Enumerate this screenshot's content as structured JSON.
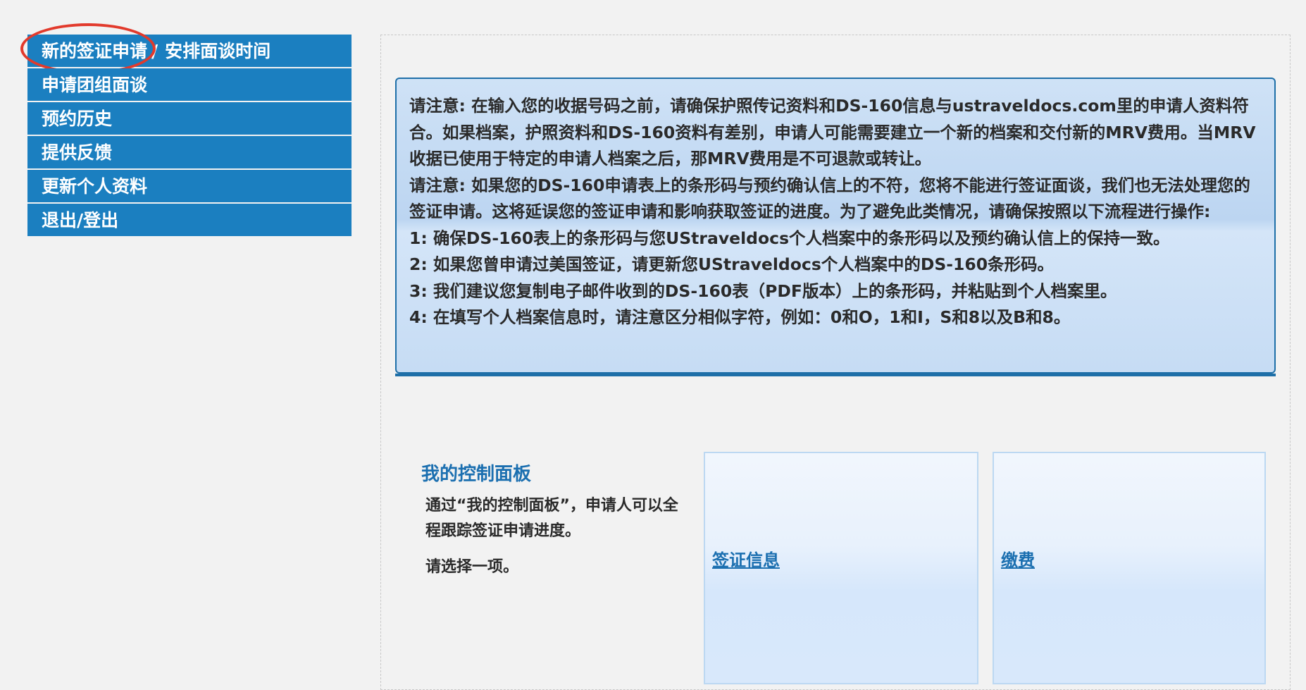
{
  "sidebar": {
    "items": [
      {
        "label": "新的签证申请",
        "sep": "/",
        "sub_label": "安排面谈时间"
      },
      {
        "label": "申请团组面谈"
      },
      {
        "label": "预约历史"
      },
      {
        "label": "提供反馈"
      },
      {
        "label": "更新个人资料"
      },
      {
        "label": "退出/登出"
      }
    ]
  },
  "notice": {
    "lines": [
      "请注意: 在输入您的收据号码之前，请确保护照传记资料和DS-160信息与ustraveldocs.com里的申请人资料符合。如果档案，护照资料和DS-160资料有差别，申请人可能需要建立一个新的档案和交付新的MRV费用。当MRV收据已使用于特定的申请人档案之后，那MRV费用是不可退款或转让。",
      "请注意: 如果您的DS-160申请表上的条形码与预约确认信上的不符，您将不能进行签证面谈，我们也无法处理您的签证申请。这将延误您的签证申请和影响获取签证的进度。为了避免此类情况，请确保按照以下流程进行操作:",
      "1: 确保DS-160表上的条形码与您UStraveldocs个人档案中的条形码以及预约确认信上的保持一致。",
      "2: 如果您曾申请过美国签证，请更新您UStraveldocs个人档案中的DS-160条形码。",
      "3: 我们建议您复制电子邮件收到的DS-160表（PDF版本）上的条形码，并粘贴到个人档案里。",
      "4: 在填写个人档案信息时，请注意区分相似字符，例如：0和O，1和I，S和8以及B和8。"
    ]
  },
  "dashboard": {
    "title": "我的控制面板",
    "description": "通过“我的控制面板”，申请人可以全程跟踪签证申请进度。",
    "choose": "请选择一项。",
    "tiles": [
      {
        "label": "签证信息"
      },
      {
        "label": "缴费"
      }
    ]
  },
  "colors": {
    "nav_bg": "#1b7fc0",
    "notice_border": "#1e6fa8",
    "link": "#1b6fb0",
    "highlight": "#e23a2c"
  }
}
